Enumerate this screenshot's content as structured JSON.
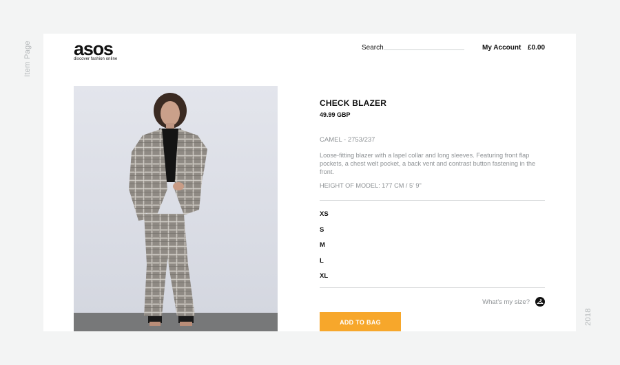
{
  "page": {
    "side_label_left": "Item Page",
    "side_label_right": "2018"
  },
  "header": {
    "logo_text": "asos",
    "logo_tagline": "discover fashion online",
    "search_label": "Search",
    "search_value": "",
    "account_label": "My Account",
    "cart_total": "£0.00"
  },
  "product": {
    "image_icon": "model-in-check-suit-photo",
    "title": "CHECK BLAZER",
    "price": "49.99 GBP",
    "color_code": "CAMEL - 2753/237",
    "description": "Loose-fitting blazer with a lapel collar and long sleeves. Featuring front flap pockets, a chest welt pocket, a back vent and contrast button fastening in the front.",
    "model_height": "HEIGHT OF MODEL: 177 CM / 5' 9\"",
    "sizes": [
      "XS",
      "S",
      "M",
      "L",
      "XL"
    ],
    "size_help_label": "What's my size?",
    "size_help_icon": "hanger-icon",
    "add_to_bag_label": "ADD TO BAG"
  },
  "colors": {
    "accent": "#f7a72b",
    "page_bg": "#f3f4f4",
    "muted_text": "#8d9194"
  }
}
